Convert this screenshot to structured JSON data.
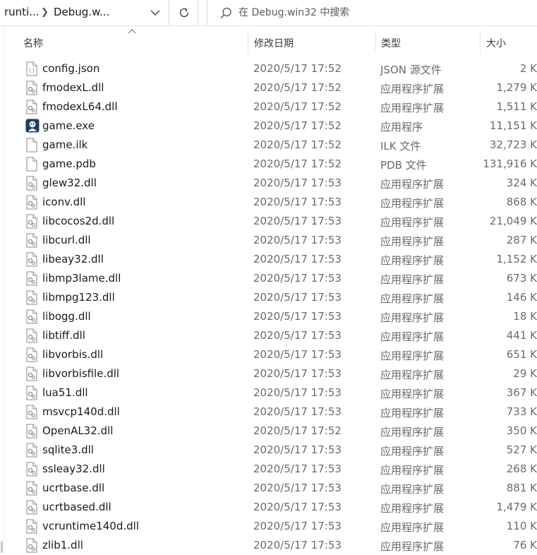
{
  "address": {
    "crumbs": [
      "runti...",
      "Debug.w..."
    ]
  },
  "search": {
    "placeholder": "在 Debug.win32 中搜索"
  },
  "columns": {
    "name": "名称",
    "date": "修改日期",
    "type": "类型",
    "size": "大小"
  },
  "colors": {
    "text": "#1a1a1a",
    "secondary_text": "#6b6b6b",
    "border": "#d9d9d9"
  },
  "files": [
    {
      "name": "config.json",
      "date": "2020/5/17 17:52",
      "type": "JSON 源文件",
      "size": "2 K",
      "icon": "json-file-icon"
    },
    {
      "name": "fmodexL.dll",
      "date": "2020/5/17 17:52",
      "type": "应用程序扩展",
      "size": "1,279 K",
      "icon": "dll-file-icon"
    },
    {
      "name": "fmodexL64.dll",
      "date": "2020/5/17 17:52",
      "type": "应用程序扩展",
      "size": "1,511 K",
      "icon": "dll-file-icon"
    },
    {
      "name": "game.exe",
      "date": "2020/5/17 17:52",
      "type": "应用程序",
      "size": "11,151 K",
      "icon": "exe-app-icon"
    },
    {
      "name": "game.ilk",
      "date": "2020/5/17 17:52",
      "type": "ILK 文件",
      "size": "32,723 K",
      "icon": "blank-file-icon"
    },
    {
      "name": "game.pdb",
      "date": "2020/5/17 17:52",
      "type": "PDB 文件",
      "size": "131,916 K",
      "icon": "blank-file-icon"
    },
    {
      "name": "glew32.dll",
      "date": "2020/5/17 17:53",
      "type": "应用程序扩展",
      "size": "324 K",
      "icon": "dll-file-icon"
    },
    {
      "name": "iconv.dll",
      "date": "2020/5/17 17:53",
      "type": "应用程序扩展",
      "size": "868 K",
      "icon": "dll-file-icon"
    },
    {
      "name": "libcocos2d.dll",
      "date": "2020/5/17 17:53",
      "type": "应用程序扩展",
      "size": "21,049 K",
      "icon": "dll-file-icon"
    },
    {
      "name": "libcurl.dll",
      "date": "2020/5/17 17:53",
      "type": "应用程序扩展",
      "size": "287 K",
      "icon": "dll-file-icon"
    },
    {
      "name": "libeay32.dll",
      "date": "2020/5/17 17:53",
      "type": "应用程序扩展",
      "size": "1,152 K",
      "icon": "dll-file-icon"
    },
    {
      "name": "libmp3lame.dll",
      "date": "2020/5/17 17:53",
      "type": "应用程序扩展",
      "size": "673 K",
      "icon": "dll-file-icon"
    },
    {
      "name": "libmpg123.dll",
      "date": "2020/5/17 17:53",
      "type": "应用程序扩展",
      "size": "146 K",
      "icon": "dll-file-icon"
    },
    {
      "name": "libogg.dll",
      "date": "2020/5/17 17:53",
      "type": "应用程序扩展",
      "size": "18 K",
      "icon": "dll-file-icon"
    },
    {
      "name": "libtiff.dll",
      "date": "2020/5/17 17:53",
      "type": "应用程序扩展",
      "size": "441 K",
      "icon": "dll-file-icon"
    },
    {
      "name": "libvorbis.dll",
      "date": "2020/5/17 17:53",
      "type": "应用程序扩展",
      "size": "651 K",
      "icon": "dll-file-icon"
    },
    {
      "name": "libvorbisfile.dll",
      "date": "2020/5/17 17:53",
      "type": "应用程序扩展",
      "size": "29 K",
      "icon": "dll-file-icon"
    },
    {
      "name": "lua51.dll",
      "date": "2020/5/17 17:53",
      "type": "应用程序扩展",
      "size": "367 K",
      "icon": "dll-file-icon"
    },
    {
      "name": "msvcp140d.dll",
      "date": "2020/5/17 17:53",
      "type": "应用程序扩展",
      "size": "733 K",
      "icon": "dll-file-icon"
    },
    {
      "name": "OpenAL32.dll",
      "date": "2020/5/17 17:52",
      "type": "应用程序扩展",
      "size": "350 K",
      "icon": "dll-file-icon"
    },
    {
      "name": "sqlite3.dll",
      "date": "2020/5/17 17:53",
      "type": "应用程序扩展",
      "size": "527 K",
      "icon": "dll-file-icon"
    },
    {
      "name": "ssleay32.dll",
      "date": "2020/5/17 17:53",
      "type": "应用程序扩展",
      "size": "268 K",
      "icon": "dll-file-icon"
    },
    {
      "name": "ucrtbase.dll",
      "date": "2020/5/17 17:53",
      "type": "应用程序扩展",
      "size": "881 K",
      "icon": "dll-file-icon"
    },
    {
      "name": "ucrtbased.dll",
      "date": "2020/5/17 17:53",
      "type": "应用程序扩展",
      "size": "1,479 K",
      "icon": "dll-file-icon"
    },
    {
      "name": "vcruntime140d.dll",
      "date": "2020/5/17 17:53",
      "type": "应用程序扩展",
      "size": "110 K",
      "icon": "dll-file-icon"
    },
    {
      "name": "zlib1.dll",
      "date": "2020/5/17 17:53",
      "type": "应用程序扩展",
      "size": "76 K",
      "icon": "dll-file-icon"
    }
  ]
}
